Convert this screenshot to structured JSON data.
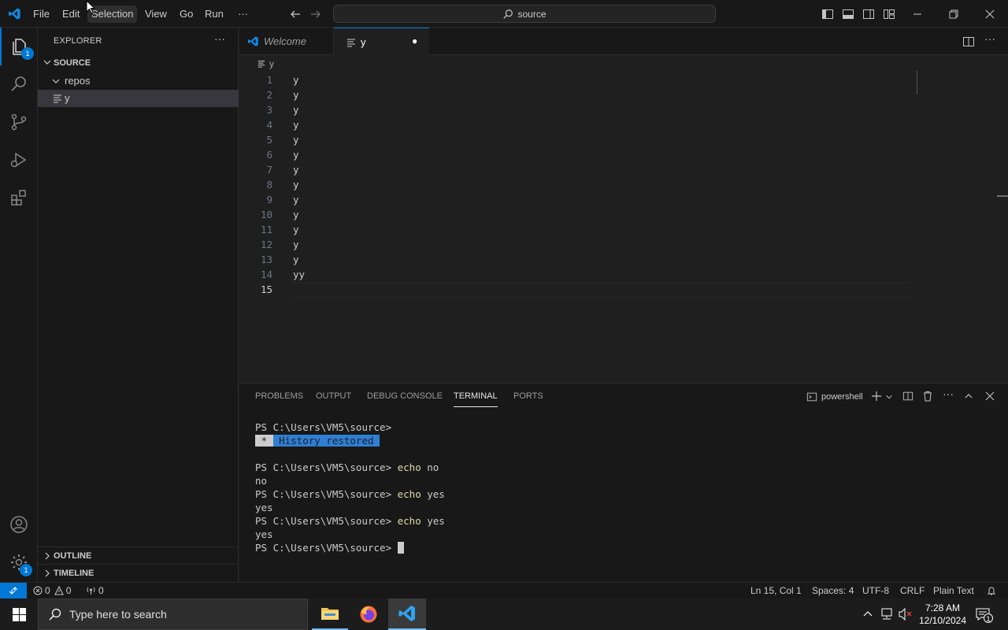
{
  "menu": {
    "items": [
      "File",
      "Edit",
      "Selection",
      "View",
      "Go",
      "Run",
      "···"
    ]
  },
  "search": {
    "text": "source"
  },
  "activity": {
    "explorer_badge": "1",
    "settings_badge": "1"
  },
  "sidebar": {
    "title": "EXPLORER",
    "more": "···",
    "root": "SOURCE",
    "folder": "repos",
    "file": "y",
    "outline": "OUTLINE",
    "timeline": "TIMELINE"
  },
  "tabs": [
    {
      "label": "Welcome"
    },
    {
      "label": "y",
      "dirty": "●"
    }
  ],
  "editor": {
    "breadcrumb": "y",
    "lines": [
      {
        "n": "1",
        "t": "y"
      },
      {
        "n": "2",
        "t": "y"
      },
      {
        "n": "3",
        "t": "y"
      },
      {
        "n": "4",
        "t": "y"
      },
      {
        "n": "5",
        "t": "y"
      },
      {
        "n": "6",
        "t": "y"
      },
      {
        "n": "7",
        "t": "y"
      },
      {
        "n": "8",
        "t": "y"
      },
      {
        "n": "9",
        "t": "y"
      },
      {
        "n": "10",
        "t": "y"
      },
      {
        "n": "11",
        "t": "y"
      },
      {
        "n": "12",
        "t": "y"
      },
      {
        "n": "13",
        "t": "y"
      },
      {
        "n": "14",
        "t": "yy"
      },
      {
        "n": "15",
        "t": ""
      }
    ]
  },
  "panel": {
    "tabs": [
      "PROBLEMS",
      "OUTPUT",
      "DEBUG CONSOLE",
      "TERMINAL",
      "PORTS"
    ],
    "shell": "powershell",
    "terminal": {
      "prompt": "PS C:\\Users\\VM5\\source> ",
      "history_mark": " * ",
      "history": " History restored ",
      "cmd1": "echo",
      "arg1": " no",
      "out1": "no",
      "cmd2": "echo",
      "arg2": " yes",
      "out2": "yes",
      "cmd3": "echo",
      "arg3": " yes",
      "out3": "yes"
    }
  },
  "status": {
    "errors": "0",
    "warnings": "0",
    "ports": "0",
    "position": "Ln 15, Col 1",
    "spaces": "Spaces: 4",
    "encoding": "UTF-8",
    "eol": "CRLF",
    "language": "Plain Text"
  },
  "taskbar": {
    "search_placeholder": "Type here to search",
    "time": "7:28 AM",
    "date": "12/10/2024",
    "notif_badge": "1"
  },
  "colors": {
    "accent": "#0078d4",
    "highlight": "#264f78"
  }
}
